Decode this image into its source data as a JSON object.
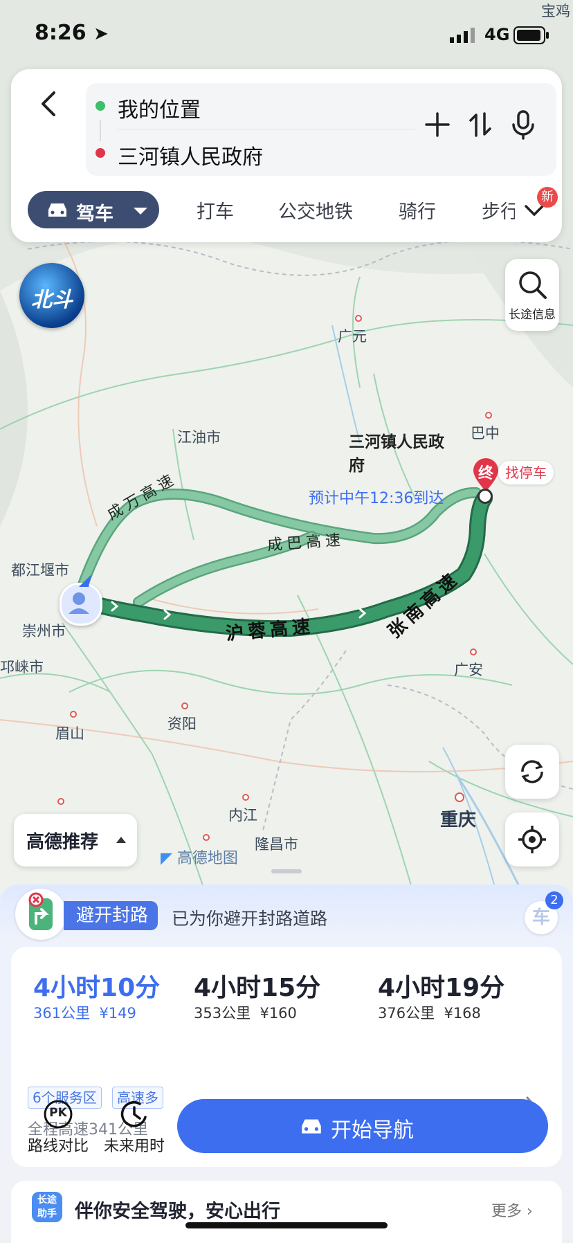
{
  "status_bar": {
    "time": "8:26",
    "network": "4G"
  },
  "route_input": {
    "origin": "我的位置",
    "destination": "三河镇人民政府"
  },
  "transport_modes": [
    {
      "label": "驾车",
      "active": true
    },
    {
      "label": "打车"
    },
    {
      "label": "公交地铁"
    },
    {
      "label": "骑行"
    },
    {
      "label": "步行"
    }
  ],
  "new_badge": "新",
  "map": {
    "beidou_logo": "北斗",
    "longdistance_btn": "长途信息",
    "destination_name_line1": "三河镇人民政",
    "destination_name_line2": "府",
    "end_marker": "终",
    "parking_label": "找停车",
    "eta": "预计中午12:36到达",
    "roads": [
      "成万高速",
      "成巴高速",
      "沪蓉高速",
      "张南高速"
    ],
    "places": [
      "广元",
      "江油市",
      "巴中",
      "都江堰市",
      "崇州市",
      "邛崃市",
      "广安",
      "眉山",
      "资阳",
      "内江",
      "隆昌市",
      "重庆",
      "宝鸡"
    ],
    "recommend_btn": "高德推荐",
    "watermark": "高德地图"
  },
  "notice": {
    "tag": "避开封路",
    "desc": "已为你避开封路道路",
    "car_badge": "车",
    "car_count": "2"
  },
  "route_options": [
    {
      "time": "4小时10分",
      "distance": "361公里",
      "cost": "¥149",
      "selected": true
    },
    {
      "time": "4小时15分",
      "distance": "353公里",
      "cost": "¥160"
    },
    {
      "time": "4小时19分",
      "distance": "376公里",
      "cost": "¥168"
    }
  ],
  "route_tags": [
    "6个服务区",
    "高速多"
  ],
  "highway_info": "全程高速341公里",
  "tools": [
    {
      "label": "路线对比",
      "icon": "PK"
    },
    {
      "label": "未来用时"
    }
  ],
  "start_nav": "开始导航",
  "safety": {
    "badge_line1": "长途",
    "badge_line2": "助手",
    "text": "伴你安全驾驶，安心出行",
    "more": "更多"
  },
  "colors": {
    "accent": "#3d6eef",
    "route_main": "#2f8a5e",
    "route_alt": "#7cbf9a",
    "dest_red": "#e0364a"
  }
}
